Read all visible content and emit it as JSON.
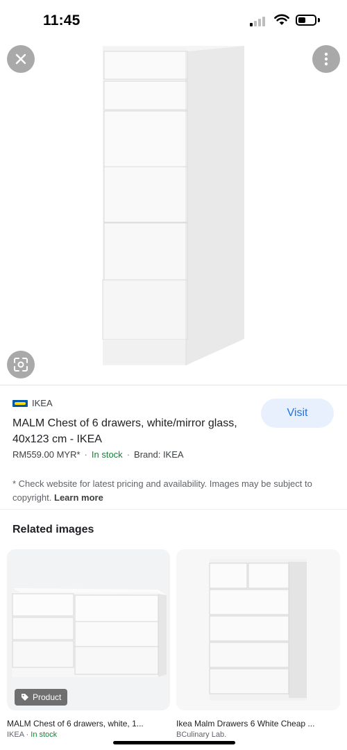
{
  "status_bar": {
    "time": "11:45",
    "battery_level": 0.45
  },
  "viewer": {
    "close_icon": "close-icon",
    "more_icon": "more-vertical-icon",
    "lens_icon": "google-lens-icon"
  },
  "product": {
    "source_name": "IKEA",
    "title": "MALM Chest of 6 drawers, white/mirror glass, 40x123 cm - IKEA",
    "price": "RM559.00 MYR*",
    "stock": "In stock",
    "brand": "Brand: IKEA",
    "visit_label": "Visit",
    "disclaimer": "* Check website for latest pricing and availability. Images may be subject to copyright.",
    "learn_more": "Learn more"
  },
  "related": {
    "title": "Related images",
    "items": [
      {
        "chip": "Product",
        "caption": "MALM Chest of 6 drawers, white, 1...",
        "source": "IKEA",
        "stock": "In stock"
      },
      {
        "caption": "Ikea Malm Drawers 6 White Cheap ...",
        "source": "BCulinary Lab."
      }
    ]
  },
  "colors": {
    "accent": "#1a73e8",
    "stock_green": "#188038",
    "visit_bg": "#e8f0fe"
  }
}
